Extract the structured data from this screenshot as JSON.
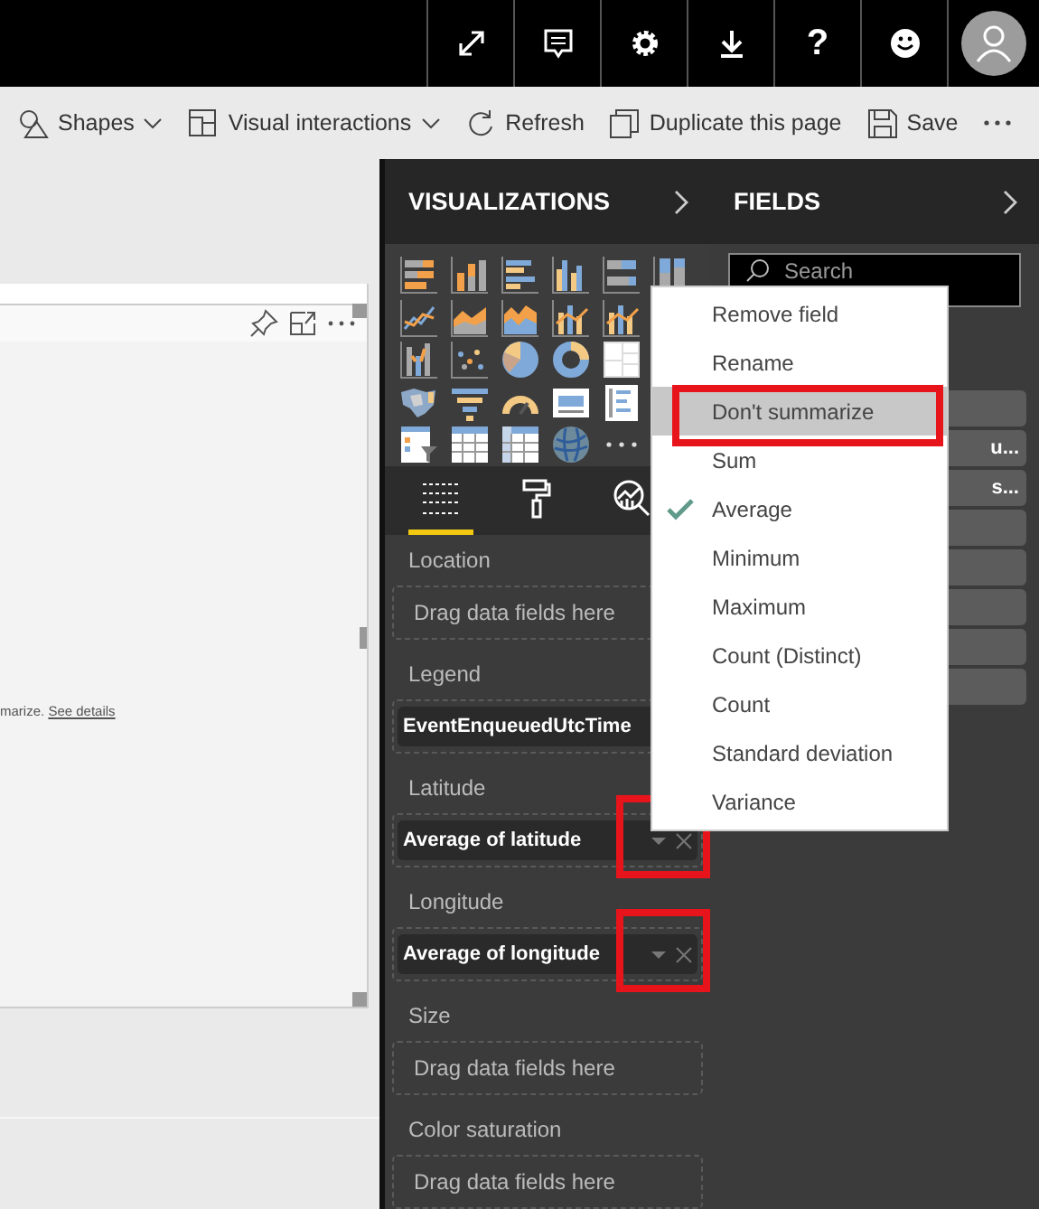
{
  "top_bar": {
    "buttons": [
      {
        "kind": "expand"
      },
      {
        "kind": "comment"
      },
      {
        "kind": "settings"
      },
      {
        "kind": "download"
      },
      {
        "kind": "help",
        "label": "?"
      },
      {
        "kind": "feedback"
      },
      {
        "kind": "avatar"
      }
    ]
  },
  "toolbar": {
    "items": [
      {
        "kind": "shapes",
        "label": "Shapes",
        "dropdown": true
      },
      {
        "kind": "interactions",
        "label": "Visual interactions",
        "dropdown": true
      },
      {
        "kind": "refresh",
        "label": "Refresh",
        "dropdown": false
      },
      {
        "kind": "duplicate",
        "label": "Duplicate this page",
        "dropdown": false
      },
      {
        "kind": "save",
        "label": "Save",
        "dropdown": false
      },
      {
        "kind": "more"
      }
    ]
  },
  "canvas": {
    "visual": {
      "message": "marize.",
      "link": "See details"
    }
  },
  "visualizations": {
    "title": "VISUALIZATIONS",
    "tabs": [
      {
        "kind": "fields",
        "selected": true
      },
      {
        "kind": "format",
        "selected": false
      },
      {
        "kind": "analytics",
        "selected": false
      }
    ],
    "wells": [
      {
        "label": "Location",
        "hint": "Drag data fields here",
        "marked": false
      },
      {
        "label": "Legend",
        "value": "EventEnqueuedUtcTime",
        "marked": false
      },
      {
        "label": "Latitude",
        "value": "Average of latitude",
        "marked": true
      },
      {
        "label": "Longitude",
        "value": "Average of longitude",
        "marked": true
      },
      {
        "label": "Size",
        "hint": "Drag data fields here",
        "marked": false
      },
      {
        "label": "Color saturation",
        "hint": "Drag data fields here",
        "marked": false
      }
    ]
  },
  "fields": {
    "title": "FIELDS",
    "search": {
      "placeholder": "Search"
    },
    "items": [
      {
        "kind": "blank"
      },
      {
        "kind": "labeled",
        "label": "u..."
      },
      {
        "kind": "labeled",
        "label": "s..."
      },
      {
        "kind": "blank"
      },
      {
        "kind": "blank"
      },
      {
        "kind": "blank"
      },
      {
        "kind": "blank"
      },
      {
        "kind": "blank"
      }
    ]
  },
  "context_menu": {
    "items": [
      {
        "label": "Remove field",
        "checked": false,
        "highlighted": false,
        "marked": false
      },
      {
        "label": "Rename",
        "checked": false,
        "highlighted": false,
        "marked": false
      },
      {
        "label": "Don't summarize",
        "checked": false,
        "highlighted": true,
        "marked": true
      },
      {
        "label": "Sum",
        "checked": false,
        "highlighted": false,
        "marked": false
      },
      {
        "label": "Average",
        "checked": true,
        "highlighted": false,
        "marked": false
      },
      {
        "label": "Minimum",
        "checked": false,
        "highlighted": false,
        "marked": false
      },
      {
        "label": "Maximum",
        "checked": false,
        "highlighted": false,
        "marked": false
      },
      {
        "label": "Count (Distinct)",
        "checked": false,
        "highlighted": false,
        "marked": false
      },
      {
        "label": "Count",
        "checked": false,
        "highlighted": false,
        "marked": false
      },
      {
        "label": "Standard deviation",
        "checked": false,
        "highlighted": false,
        "marked": false
      },
      {
        "label": "Variance",
        "checked": false,
        "highlighted": false,
        "marked": false
      }
    ]
  }
}
